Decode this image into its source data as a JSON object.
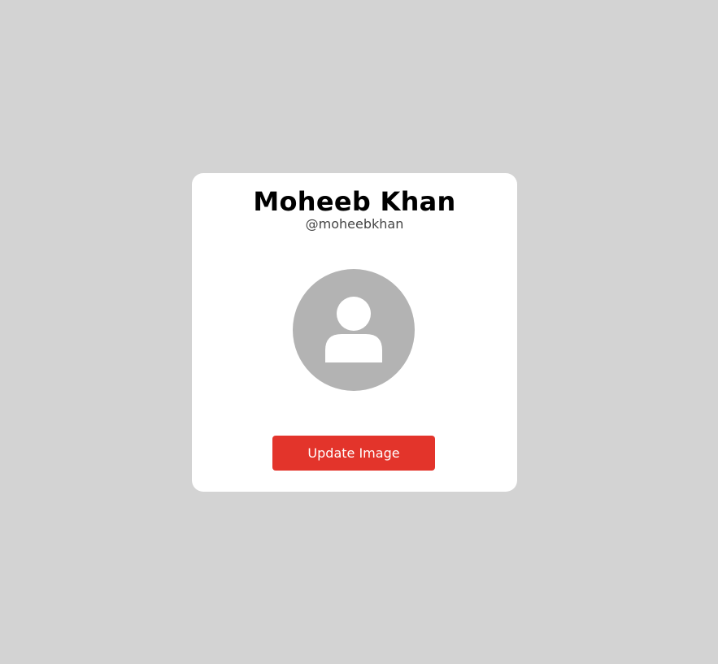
{
  "profile": {
    "name": "Moheeb Khan",
    "username": "@moheebkhan",
    "avatar_icon": "user-placeholder-icon",
    "update_button_label": "Update Image"
  },
  "colors": {
    "background": "#d3d3d3",
    "card": "#ffffff",
    "avatar_bg": "#b3b3b3",
    "button": "#e3342b",
    "button_text": "#ffffff"
  }
}
